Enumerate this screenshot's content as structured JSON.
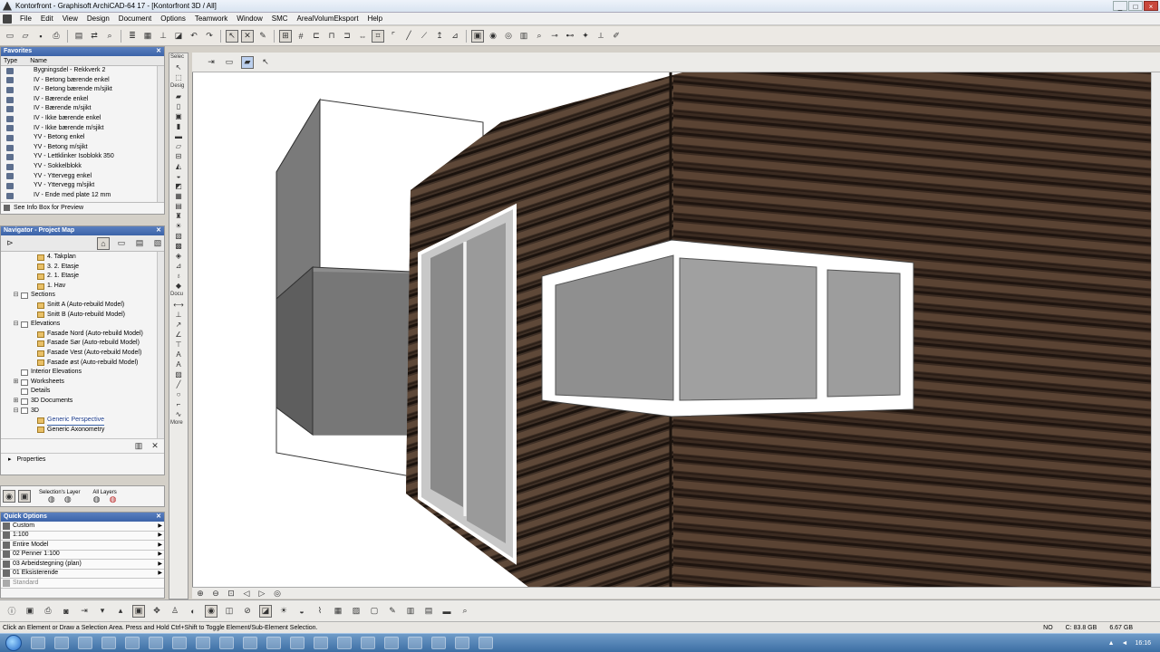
{
  "window": {
    "title": "Kontorfront - Graphisoft ArchiCAD-64 17 - [Kontorfront 3D / All]",
    "controls": [
      "_",
      "□",
      "×"
    ]
  },
  "menu": [
    "File",
    "Edit",
    "View",
    "Design",
    "Document",
    "Options",
    "Teamwork",
    "Window",
    "SMC",
    "ArealVolumEksport",
    "Help"
  ],
  "favorites": {
    "title": "Favorites",
    "col_type": "Type",
    "col_name": "Name",
    "items": [
      "Bygningsdel - Rekkverk 2",
      "IV - Betong bærende enkel",
      "IV - Betong bærende m/sjikt",
      "IV - Bærende enkel",
      "IV - Bærende m/sjikt",
      "IV - Ikke bærende enkel",
      "IV - Ikke bærende m/sjikt",
      "YV - Betong enkel",
      "YV - Betong m/sjikt",
      "YV - Lettklinker Isoblokk 350",
      "YV - Sokkelblokk",
      "YV - Yttervegg enkel",
      "YV - Yttervegg m/sjikt",
      "IV - Ende med plate 12 mm"
    ],
    "footer": "See Info Box for Preview"
  },
  "navigator": {
    "title": "Navigator - Project Map",
    "items": [
      {
        "label": "4. Takplan",
        "indent": 3,
        "icon": "folder",
        "expander": ""
      },
      {
        "label": "3. 2. Etasje",
        "indent": 3,
        "icon": "folder",
        "expander": ""
      },
      {
        "label": "2. 1. Etasje",
        "indent": 3,
        "icon": "folder",
        "expander": ""
      },
      {
        "label": "1. Hav",
        "indent": 3,
        "icon": "folder",
        "expander": ""
      },
      {
        "label": "Sections",
        "indent": 1,
        "icon": "doc",
        "expander": "⊟"
      },
      {
        "label": "Snitt A (Auto-rebuild Model)",
        "indent": 3,
        "icon": "folder",
        "expander": ""
      },
      {
        "label": "Snitt B (Auto-rebuild Model)",
        "indent": 3,
        "icon": "folder",
        "expander": ""
      },
      {
        "label": "Elevations",
        "indent": 1,
        "icon": "doc",
        "expander": "⊟"
      },
      {
        "label": "Fasade Nord (Auto-rebuild Model)",
        "indent": 3,
        "icon": "folder",
        "expander": ""
      },
      {
        "label": "Fasade Sør (Auto-rebuild Model)",
        "indent": 3,
        "icon": "folder",
        "expander": ""
      },
      {
        "label": "Fasade Vest (Auto-rebuild Model)",
        "indent": 3,
        "icon": "folder",
        "expander": ""
      },
      {
        "label": "Fasade øst (Auto-rebuild Model)",
        "indent": 3,
        "icon": "folder",
        "expander": ""
      },
      {
        "label": "Interior Elevations",
        "indent": 1,
        "icon": "doc",
        "expander": ""
      },
      {
        "label": "Worksheets",
        "indent": 1,
        "icon": "doc",
        "expander": "⊞"
      },
      {
        "label": "Details",
        "indent": 1,
        "icon": "doc",
        "expander": ""
      },
      {
        "label": "3D Documents",
        "indent": 1,
        "icon": "doc",
        "expander": "⊞"
      },
      {
        "label": "3D",
        "indent": 1,
        "icon": "doc",
        "expander": "⊟"
      },
      {
        "label": "Generic Perspective",
        "indent": 3,
        "icon": "folder",
        "expander": "",
        "selected": true
      },
      {
        "label": "Generic Axonometry",
        "indent": 3,
        "icon": "folder",
        "expander": ""
      }
    ],
    "properties_label": "Properties"
  },
  "layers": {
    "selection_layer": "Selection's Layer",
    "all_layers": "All Layers"
  },
  "quick_options": {
    "title": "Quick Options",
    "rows": [
      "Custom",
      "1:100",
      "Entire Model",
      "02 Penner 1:100",
      "03 Arbeidstegning (plan)",
      "01 Eksisterende",
      "Standard"
    ]
  },
  "toolbox": {
    "select_label": "Selec",
    "design_label": "Desig",
    "document_label": "Docu",
    "more_label": "More"
  },
  "statusbar": {
    "hint": "Click an Element or Draw a Selection Area. Press and Hold Ctrl+Shift to Toggle Element/Sub-Element Selection.",
    "lang": "NO",
    "disk": "C: 83.8 GB",
    "memory": "6.67 GB",
    "time": "16:16"
  },
  "colors": {
    "title_accent": "#3b63a8",
    "wood_dark": "#3a2a20",
    "wood_light": "#6b5242",
    "facade_grey": "#6e6e6e"
  }
}
